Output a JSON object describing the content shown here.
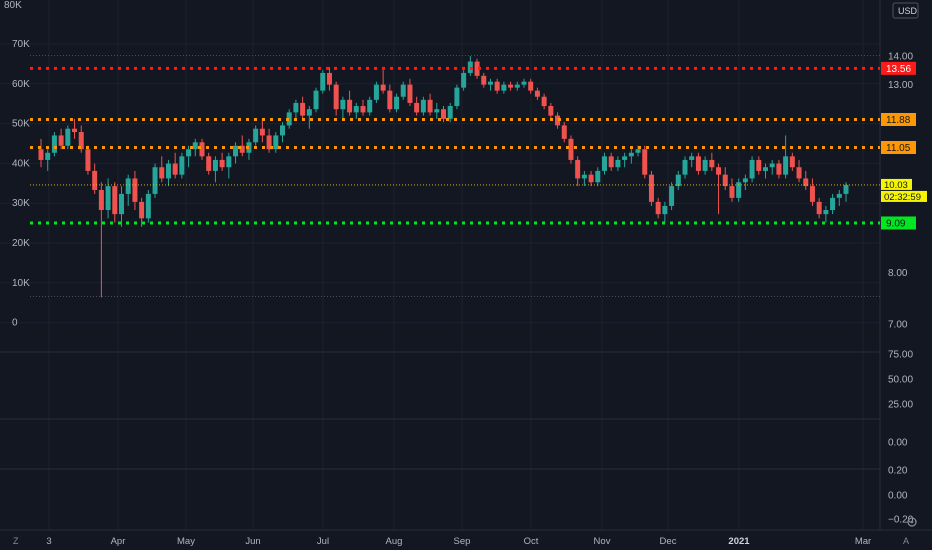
{
  "currency": "USD",
  "footer": {
    "left_icon": "Z",
    "right_icon": "A",
    "settings_icon": "gear-icon"
  },
  "chart_data": {
    "type": "candlestick",
    "main_pane": {
      "price_axis": {
        "ticks": [
          "14.00",
          "13.00",
          "8.00",
          "7.00"
        ],
        "range": [
          6.95,
          14.35
        ]
      },
      "volume_axis": {
        "ticks": [
          "70K",
          "60K",
          "50K",
          "40K",
          "30K",
          "20K",
          "10K",
          "0"
        ],
        "range": [
          -8000,
          80000
        ]
      },
      "volume_top_label": "80K",
      "time_axis": {
        "labels": [
          "3",
          "Apr",
          "May",
          "Jun",
          "Jul",
          "Aug",
          "Sep",
          "Oct",
          "Nov",
          "Dec",
          "2021",
          "Mar"
        ]
      },
      "last_price": {
        "value": 10.03,
        "label": "10.03",
        "countdown": "02:32:59",
        "color": "#f5f500"
      },
      "horizontal_levels": [
        {
          "value": 13.56,
          "label": "13.56",
          "color": "#ff1a1a"
        },
        {
          "value": 11.88,
          "label": "11.88",
          "color": "#ff9800"
        },
        {
          "value": 11.05,
          "label": "11.05",
          "color": "#ff9800"
        },
        {
          "value": 9.09,
          "label": "9.09",
          "color": "#00e620"
        }
      ],
      "price_high": 14.02,
      "price_low": 7.52,
      "candles_ohlc": [
        [
          11.0,
          11.3,
          10.5,
          10.7
        ],
        [
          10.7,
          11.0,
          10.4,
          10.9
        ],
        [
          10.9,
          11.5,
          10.8,
          11.4
        ],
        [
          11.4,
          11.6,
          11.0,
          11.1
        ],
        [
          11.1,
          11.7,
          11.0,
          11.6
        ],
        [
          11.6,
          11.9,
          11.3,
          11.5
        ],
        [
          11.5,
          11.7,
          10.9,
          11.0
        ],
        [
          11.0,
          11.1,
          10.3,
          10.4
        ],
        [
          10.4,
          10.6,
          9.8,
          9.9
        ],
        [
          9.9,
          10.1,
          7.5,
          9.4
        ],
        [
          9.4,
          10.2,
          9.2,
          10.0
        ],
        [
          10.0,
          10.1,
          9.1,
          9.3
        ],
        [
          9.3,
          10.0,
          9.0,
          9.8
        ],
        [
          9.8,
          10.3,
          9.5,
          10.2
        ],
        [
          10.2,
          10.4,
          9.4,
          9.6
        ],
        [
          9.6,
          9.7,
          9.0,
          9.2
        ],
        [
          9.2,
          9.9,
          9.1,
          9.8
        ],
        [
          9.8,
          10.6,
          9.7,
          10.5
        ],
        [
          10.5,
          10.8,
          10.1,
          10.2
        ],
        [
          10.2,
          10.7,
          10.0,
          10.6
        ],
        [
          10.6,
          10.9,
          10.2,
          10.3
        ],
        [
          10.3,
          10.9,
          10.2,
          10.8
        ],
        [
          10.8,
          11.1,
          10.5,
          11.0
        ],
        [
          11.0,
          11.3,
          10.8,
          11.2
        ],
        [
          11.2,
          11.3,
          10.7,
          10.8
        ],
        [
          10.8,
          10.9,
          10.3,
          10.4
        ],
        [
          10.4,
          10.8,
          10.1,
          10.7
        ],
        [
          10.7,
          10.9,
          10.4,
          10.5
        ],
        [
          10.5,
          10.9,
          10.2,
          10.8
        ],
        [
          10.8,
          11.2,
          10.6,
          11.1
        ],
        [
          11.1,
          11.4,
          10.8,
          10.9
        ],
        [
          10.9,
          11.3,
          10.7,
          11.2
        ],
        [
          11.2,
          11.7,
          11.1,
          11.6
        ],
        [
          11.6,
          11.9,
          11.2,
          11.4
        ],
        [
          11.4,
          11.6,
          10.9,
          11.0
        ],
        [
          11.0,
          11.5,
          10.9,
          11.4
        ],
        [
          11.4,
          11.8,
          11.2,
          11.7
        ],
        [
          11.7,
          12.2,
          11.6,
          12.1
        ],
        [
          12.1,
          12.5,
          11.9,
          12.4
        ],
        [
          12.4,
          12.6,
          11.9,
          12.0
        ],
        [
          12.0,
          12.3,
          11.6,
          12.2
        ],
        [
          12.2,
          12.9,
          12.1,
          12.8
        ],
        [
          12.8,
          13.5,
          12.7,
          13.4
        ],
        [
          13.4,
          13.6,
          12.8,
          13.0
        ],
        [
          13.0,
          13.1,
          12.0,
          12.2
        ],
        [
          12.2,
          12.6,
          11.9,
          12.5
        ],
        [
          12.5,
          12.8,
          12.0,
          12.1
        ],
        [
          12.1,
          12.4,
          11.9,
          12.3
        ],
        [
          12.3,
          12.5,
          12.0,
          12.1
        ],
        [
          12.1,
          12.6,
          12.0,
          12.5
        ],
        [
          12.5,
          13.1,
          12.4,
          13.0
        ],
        [
          13.0,
          13.5,
          12.7,
          12.8
        ],
        [
          12.8,
          13.0,
          12.1,
          12.2
        ],
        [
          12.2,
          12.7,
          12.1,
          12.6
        ],
        [
          12.6,
          13.1,
          12.5,
          13.0
        ],
        [
          13.0,
          13.2,
          12.3,
          12.4
        ],
        [
          12.4,
          12.6,
          12.0,
          12.1
        ],
        [
          12.1,
          12.6,
          12.0,
          12.5
        ],
        [
          12.5,
          12.7,
          12.0,
          12.1
        ],
        [
          12.1,
          12.4,
          11.9,
          12.2
        ],
        [
          12.2,
          12.3,
          11.8,
          11.9
        ],
        [
          11.9,
          12.4,
          11.8,
          12.3
        ],
        [
          12.3,
          13.0,
          12.2,
          12.9
        ],
        [
          12.9,
          13.5,
          12.8,
          13.4
        ],
        [
          13.4,
          14.0,
          13.3,
          13.8
        ],
        [
          13.8,
          13.9,
          13.2,
          13.3
        ],
        [
          13.3,
          13.4,
          12.9,
          13.0
        ],
        [
          13.0,
          13.2,
          12.8,
          13.1
        ],
        [
          13.1,
          13.2,
          12.7,
          12.8
        ],
        [
          12.8,
          13.1,
          12.7,
          13.0
        ],
        [
          13.0,
          13.1,
          12.8,
          12.9
        ],
        [
          12.9,
          13.1,
          12.8,
          13.0
        ],
        [
          13.0,
          13.2,
          12.9,
          13.1
        ],
        [
          13.1,
          13.2,
          12.7,
          12.8
        ],
        [
          12.8,
          12.9,
          12.5,
          12.6
        ],
        [
          12.6,
          12.7,
          12.2,
          12.3
        ],
        [
          12.3,
          12.4,
          11.9,
          12.0
        ],
        [
          12.0,
          12.1,
          11.6,
          11.7
        ],
        [
          11.7,
          11.8,
          11.2,
          11.3
        ],
        [
          11.3,
          11.4,
          10.6,
          10.7
        ],
        [
          10.7,
          10.8,
          10.0,
          10.2
        ],
        [
          10.2,
          10.4,
          10.0,
          10.3
        ],
        [
          10.3,
          10.4,
          10.0,
          10.1
        ],
        [
          10.1,
          10.5,
          10.0,
          10.4
        ],
        [
          10.4,
          10.9,
          10.3,
          10.8
        ],
        [
          10.8,
          10.9,
          10.4,
          10.5
        ],
        [
          10.5,
          10.8,
          10.4,
          10.7
        ],
        [
          10.7,
          10.9,
          10.5,
          10.8
        ],
        [
          10.8,
          11.0,
          10.6,
          10.9
        ],
        [
          10.9,
          11.1,
          10.8,
          11.0
        ],
        [
          11.0,
          11.1,
          10.2,
          10.3
        ],
        [
          10.3,
          10.4,
          9.5,
          9.6
        ],
        [
          9.6,
          9.7,
          9.2,
          9.3
        ],
        [
          9.3,
          9.6,
          9.1,
          9.5
        ],
        [
          9.5,
          10.1,
          9.4,
          10.0
        ],
        [
          10.0,
          10.4,
          9.9,
          10.3
        ],
        [
          10.3,
          10.8,
          10.2,
          10.7
        ],
        [
          10.7,
          10.9,
          10.5,
          10.8
        ],
        [
          10.8,
          10.9,
          10.3,
          10.4
        ],
        [
          10.4,
          10.8,
          10.3,
          10.7
        ],
        [
          10.7,
          10.9,
          10.4,
          10.5
        ],
        [
          10.5,
          10.6,
          9.3,
          10.3
        ],
        [
          10.3,
          10.5,
          9.9,
          10.0
        ],
        [
          10.0,
          10.2,
          9.6,
          9.7
        ],
        [
          9.7,
          10.2,
          9.6,
          10.1
        ],
        [
          10.1,
          10.3,
          9.9,
          10.2
        ],
        [
          10.2,
          10.8,
          10.1,
          10.7
        ],
        [
          10.7,
          10.8,
          10.3,
          10.4
        ],
        [
          10.4,
          10.6,
          10.2,
          10.5
        ],
        [
          10.5,
          10.7,
          10.3,
          10.6
        ],
        [
          10.6,
          10.7,
          10.2,
          10.3
        ],
        [
          10.3,
          11.4,
          10.2,
          10.8
        ],
        [
          10.8,
          10.9,
          10.4,
          10.5
        ],
        [
          10.5,
          10.7,
          10.1,
          10.2
        ],
        [
          10.2,
          10.4,
          9.9,
          10.0
        ],
        [
          10.0,
          10.2,
          9.5,
          9.6
        ],
        [
          9.6,
          9.7,
          9.2,
          9.3
        ],
        [
          9.3,
          9.5,
          9.1,
          9.4
        ],
        [
          9.4,
          9.8,
          9.3,
          9.7
        ],
        [
          9.7,
          9.9,
          9.5,
          9.8
        ],
        [
          9.8,
          10.1,
          9.6,
          10.03
        ]
      ]
    },
    "panes": [
      {
        "name": "pane-2",
        "ticks": [
          "75.00",
          "50.00",
          "25.00"
        ]
      },
      {
        "name": "pane-3",
        "ticks": [
          "0.00"
        ]
      },
      {
        "name": "pane-4",
        "ticks": [
          "0.20",
          "0.00",
          "−0.20"
        ]
      }
    ]
  }
}
